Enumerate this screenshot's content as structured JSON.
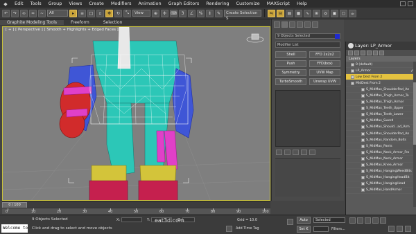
{
  "menu": {
    "logo": "◆",
    "items": [
      "Edit",
      "Tools",
      "Group",
      "Views",
      "Create",
      "Modifiers",
      "Animation",
      "Graph Editors",
      "Rendering",
      "Customize",
      "MAXScript",
      "Help"
    ]
  },
  "toolbar": {
    "filter_value": "All",
    "view_value": "View",
    "selection_set_placeholder": "Create Selection S"
  },
  "ribbon": {
    "tabs": [
      "Graphite Modeling Tools",
      "Freeform",
      "Selection"
    ]
  },
  "viewport": {
    "label": "[ + ] [ Perspective ] [ Smooth + Highlights + Edged Faces ]"
  },
  "command_panel": {
    "selection_label": "9 Objects Selected",
    "modifier_list": "Modifier List",
    "color_swatch": "#1f2ad1",
    "modifier_buttons": [
      "Shell",
      "FFD 2x2x2",
      "Push",
      "FFD(box)",
      "Symmetry",
      "UVW Map",
      "TurboSmooth",
      "Unwrap UVW"
    ]
  },
  "layers": {
    "title": "Layer: LP_Armor",
    "header": "Layers",
    "rows": [
      {
        "label": "0 (default)",
        "level": 0,
        "selected": false,
        "check": ""
      },
      {
        "label": "LP_Armor",
        "level": 0,
        "selected": false,
        "check": "✓"
      },
      {
        "label": "Low Dest From 2",
        "level": 0,
        "selected": true,
        "check": ""
      },
      {
        "label": "MidDest From 2",
        "level": 0,
        "selected": false,
        "check": ""
      },
      {
        "label": "S_MidMax_ShoulderPad_An",
        "level": 2,
        "selected": false,
        "check": ""
      },
      {
        "label": "S_MidMax_Thigh_Armor_Ta",
        "level": 2,
        "selected": false,
        "check": ""
      },
      {
        "label": "S_MidMax_Thigh_Armor",
        "level": 2,
        "selected": false,
        "check": ""
      },
      {
        "label": "S_MidMax_Teeth_Upper",
        "level": 2,
        "selected": false,
        "check": ""
      },
      {
        "label": "S_MidMax_Teeth_Lower",
        "level": 2,
        "selected": false,
        "check": ""
      },
      {
        "label": "S_MidMax_Sword",
        "level": 2,
        "selected": false,
        "check": ""
      },
      {
        "label": "S_MidMax_Should...ad_Arm",
        "level": 2,
        "selected": false,
        "check": ""
      },
      {
        "label": "S_MidMax_ShoulderPad_An",
        "level": 2,
        "selected": false,
        "check": ""
      },
      {
        "label": "S_MidMax_Random_Bolts",
        "level": 2,
        "selected": false,
        "check": ""
      },
      {
        "label": "S_MidMax_Pants",
        "level": 2,
        "selected": false,
        "check": ""
      },
      {
        "label": "S_MidMax_Neck_Armor_Fro",
        "level": 2,
        "selected": false,
        "check": ""
      },
      {
        "label": "S_MidMax_Neck_Armor",
        "level": 2,
        "selected": false,
        "check": ""
      },
      {
        "label": "S_MidMax_Knee_Armor",
        "level": 2,
        "selected": false,
        "check": ""
      },
      {
        "label": "S_MidMax_HangingWeedBits",
        "level": 2,
        "selected": false,
        "check": ""
      },
      {
        "label": "S_MidMax_HangingHeadBit",
        "level": 2,
        "selected": false,
        "check": ""
      },
      {
        "label": "S_MidMax_HangingHead",
        "level": 2,
        "selected": false,
        "check": ""
      },
      {
        "label": "S_MidMax_HandArmor",
        "level": 2,
        "selected": false,
        "check": ""
      }
    ]
  },
  "timeline": {
    "frame_display": "0 / 100",
    "ticks": [
      "0",
      "10",
      "20",
      "30",
      "40",
      "50",
      "60",
      "70",
      "80",
      "90",
      "100"
    ]
  },
  "status": {
    "maxscript": "Welcome to",
    "objects_selected": "9 Objects Selected",
    "prompt": "Click and drag to select and move objects",
    "coord_x": "X:",
    "coord_y": "Y:",
    "coord_z": "Z:",
    "grid": "Grid = 10.0",
    "add_time_tag": "Add Time Tag",
    "watermark": "eat3d.com",
    "auto_key": "Auto",
    "set_key": "Set K",
    "selected_option": "Selected",
    "key_filters": "Filters..."
  }
}
